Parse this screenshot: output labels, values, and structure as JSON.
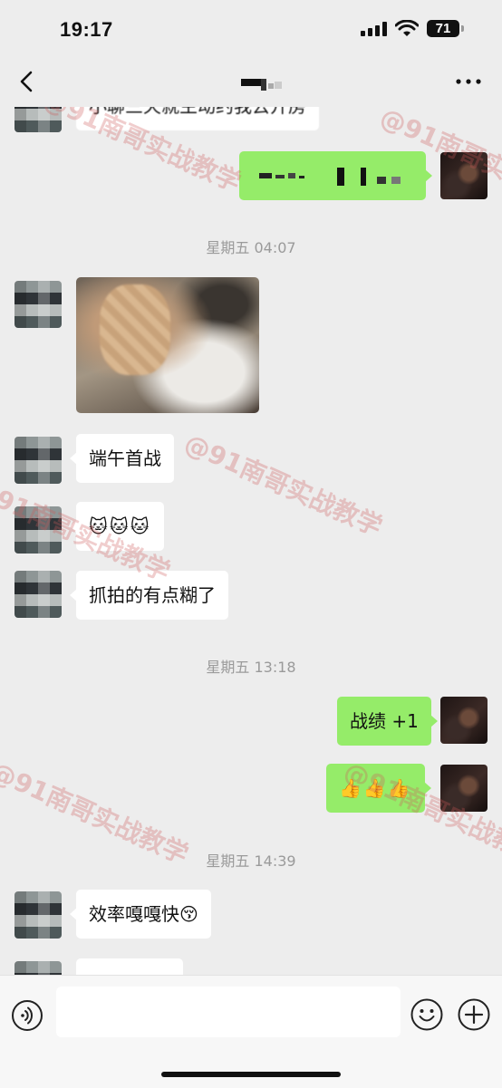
{
  "status_bar": {
    "time": "19:17",
    "battery": "71"
  },
  "watermark": {
    "text": "@91南哥实战教学"
  },
  "messages": {
    "top_partial_text": "小聊三天就主动约我去开房",
    "timestamp_1": "星期五 04:07",
    "msg_1": "端午首战",
    "msg_2_emoji": "🐱🐱🐱",
    "msg_3": "抓拍的有点糊了",
    "timestamp_2": "星期五 13:18",
    "my_msg_1": "战绩 +1",
    "my_msg_2_emoji": "👍👍👍",
    "timestamp_3": "星期五 14:39",
    "msg_4": "效率嘎嘎快😚"
  },
  "input": {
    "placeholder": ""
  },
  "icons": [
    "back-icon",
    "more-icon",
    "voice-icon",
    "emoji-icon",
    "plus-icon",
    "signal-icon",
    "wifi-icon",
    "battery-icon"
  ]
}
